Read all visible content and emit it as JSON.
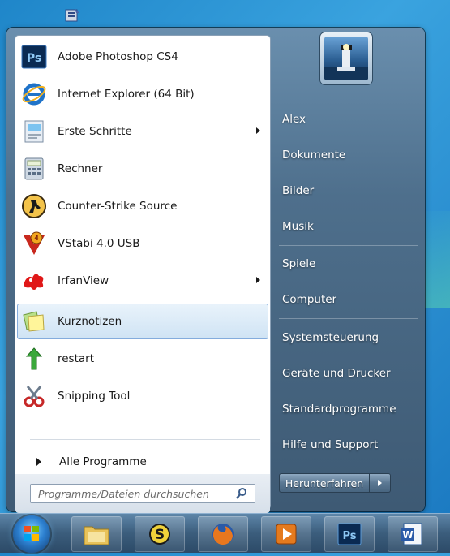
{
  "start_menu": {
    "programs": [
      {
        "label": "Adobe Photoshop CS4",
        "icon": "photoshop-icon",
        "submenu": false,
        "selected": false
      },
      {
        "label": "Internet Explorer (64 Bit)",
        "icon": "internet-explorer-icon",
        "submenu": false,
        "selected": false
      },
      {
        "label": "Erste Schritte",
        "icon": "getting-started-icon",
        "submenu": true,
        "selected": false
      },
      {
        "label": "Rechner",
        "icon": "calculator-icon",
        "submenu": false,
        "selected": false
      },
      {
        "label": "Counter-Strike Source",
        "icon": "counter-strike-icon",
        "submenu": false,
        "selected": false
      },
      {
        "label": "VStabi 4.0 USB",
        "icon": "vstabi-icon",
        "submenu": false,
        "selected": false
      },
      {
        "label": "IrfanView",
        "icon": "irfanview-icon",
        "submenu": true,
        "selected": false
      },
      {
        "label": "Kurznotizen",
        "icon": "sticky-notes-icon",
        "submenu": false,
        "selected": true
      },
      {
        "label": "restart",
        "icon": "restart-arrow-icon",
        "submenu": false,
        "selected": false
      },
      {
        "label": "Snipping Tool",
        "icon": "snipping-tool-icon",
        "submenu": false,
        "selected": false
      }
    ],
    "all_programs_label": "Alle Programme",
    "search_placeholder": "Programme/Dateien durchsuchen",
    "right_items": [
      {
        "label": "Alex"
      },
      {
        "label": "Dokumente"
      },
      {
        "label": "Bilder"
      },
      {
        "label": "Musik"
      },
      {
        "label": "Spiele"
      },
      {
        "label": "Computer"
      },
      {
        "label": "Systemsteuerung"
      },
      {
        "label": "Geräte und Drucker"
      },
      {
        "label": "Standardprogramme"
      },
      {
        "label": "Hilfe und Support"
      }
    ],
    "shutdown_label": "Herunterfahren"
  },
  "taskbar": {
    "items": [
      "windows-explorer-icon",
      "skype-icon",
      "firefox-icon",
      "media-player-icon",
      "photoshop-icon",
      "word-icon"
    ],
    "ps_label": "Ps",
    "word_label": "W"
  },
  "colors": {
    "accent": "#2c7fcf",
    "selection": "#cfe3f4"
  }
}
